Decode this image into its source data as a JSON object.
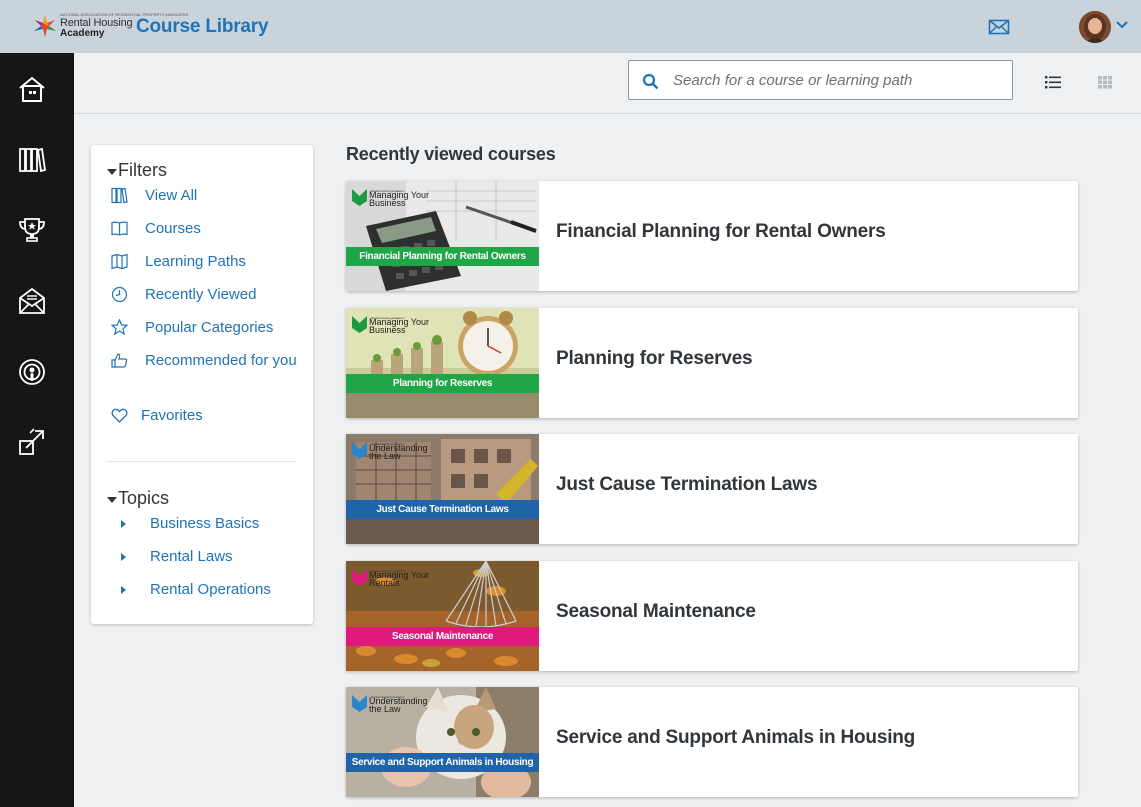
{
  "header": {
    "logo_small": "NATIONAL ASSOCIATION OF RESIDENTIAL PROPERTY MANAGERS",
    "logo_line1": "Rental Housing",
    "logo_line2": "Academy",
    "app_title": "Course Library"
  },
  "toolbar": {
    "search_placeholder": "Search for a course or learning path"
  },
  "filters": {
    "title": "Filters",
    "items": [
      {
        "label": "View All",
        "icon": "view-all-icon"
      },
      {
        "label": "Courses",
        "icon": "book-icon"
      },
      {
        "label": "Learning Paths",
        "icon": "map-icon"
      },
      {
        "label": "Recently Viewed",
        "icon": "clock-icon"
      },
      {
        "label": "Popular Categories",
        "icon": "star-icon"
      },
      {
        "label": "Recommended for you",
        "icon": "thumbs-up-icon"
      },
      {
        "label": "Favorites",
        "icon": "heart-icon"
      }
    ]
  },
  "topics": {
    "title": "Topics",
    "items": [
      {
        "label": "Business Basics"
      },
      {
        "label": "Rental Laws"
      },
      {
        "label": "Rental Operations"
      }
    ]
  },
  "main": {
    "section_title": "Recently viewed courses",
    "courses": [
      {
        "title": "Financial Planning for Rental Owners",
        "thumb_band": "Financial Planning for Rental Owners",
        "tag_small": "Rental Housing Academy",
        "tag_l1": "Managing Your",
        "tag_l2": "Business",
        "band_color": "#20a648",
        "mark_color": "#1c9a44"
      },
      {
        "title": "Planning for Reserves",
        "thumb_band": "Planning for Reserves",
        "tag_small": "Rental Housing Academy",
        "tag_l1": "Managing Your",
        "tag_l2": "Business",
        "band_color": "#20a648",
        "mark_color": "#1c9a44"
      },
      {
        "title": "Just Cause Termination Laws",
        "thumb_band": "Just Cause Termination Laws",
        "tag_small": "Rental Housing Academy",
        "tag_l1": "Understanding",
        "tag_l2": "the Law",
        "band_color": "#1f64a8",
        "mark_color": "#2b86c9"
      },
      {
        "title": "Seasonal Maintenance",
        "thumb_band": "Seasonal Maintenance",
        "tag_small": "Rental Housing Academy",
        "tag_l1": "Managing Your",
        "tag_l2": "Rentals",
        "band_color": "#e0197d",
        "mark_color": "#e0197d"
      },
      {
        "title": "Service and Support Animals in Housing",
        "thumb_band": "Service and Support Animals in Housing",
        "tag_small": "Rental Housing Academy",
        "tag_l1": "Understanding",
        "tag_l2": "the Law",
        "band_color": "#1f64a8",
        "mark_color": "#2b86c9"
      }
    ]
  },
  "colors": {
    "accent": "#1f73b7",
    "header_bg": "#c9d3dc",
    "rail_bg": "#161616"
  }
}
